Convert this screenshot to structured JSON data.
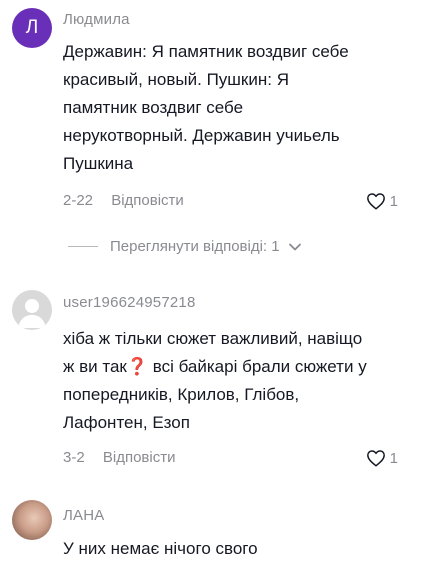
{
  "comments": [
    {
      "username": "Людмила",
      "avatar_letter": "Л",
      "text": "Державин: Я памятник воздвиг себе\nкрасивый, новый. Пушкин: Я\nпамятник воздвиг себе\nнерукотворный. Державин учиьель\nПушкина",
      "date": "2-22",
      "reply_label": "Відповісти",
      "likes": "1"
    },
    {
      "username": "user196624957218",
      "text": "хіба ж тільки сюжет важливий, навіщо\nж ви так❓ всі байкарі брали сюжети у\nпопередників, Крилов, Глібов,\nЛафонтен, Езоп",
      "date": "3-2",
      "reply_label": "Відповісти",
      "likes": "1"
    },
    {
      "username": "ЛАНА",
      "text": "У них немає нічого свого"
    }
  ],
  "view_replies_label": "Переглянути відповіді: 1"
}
